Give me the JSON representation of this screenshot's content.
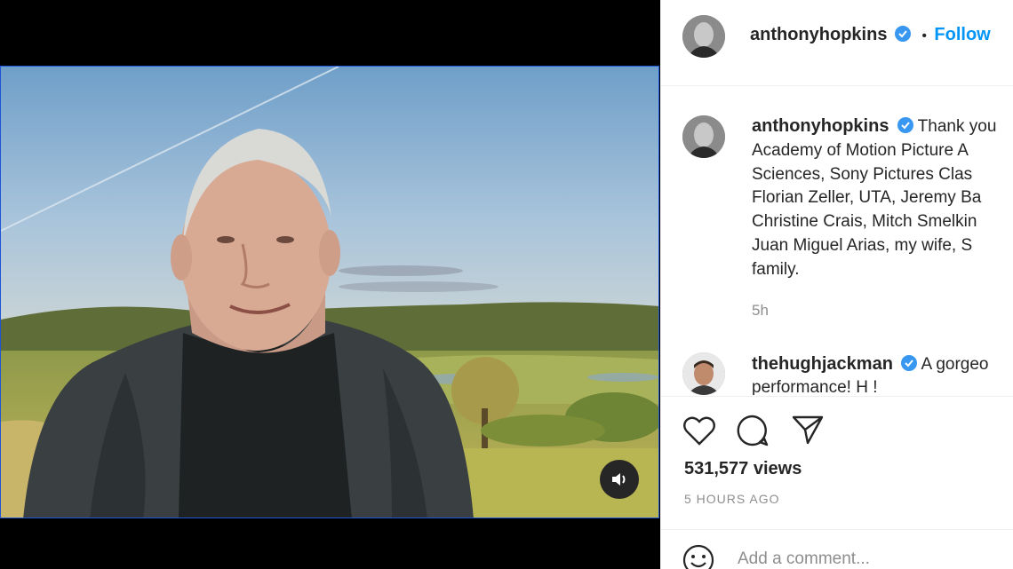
{
  "post": {
    "username": "anthonyhopkins",
    "separator": "•",
    "follow_label": "Follow"
  },
  "caption": {
    "username": "anthonyhopkins",
    "lines": [
      "Thank you",
      "Academy of Motion Picture A",
      "Sciences, Sony Pictures Clas",
      "Florian Zeller, UTA, Jeremy Ba",
      "Christine Crais, Mitch Smelkin",
      "Juan Miguel Arias, my wife, S",
      "family."
    ],
    "time": "5h"
  },
  "comment": {
    "username": "thehughjackman",
    "text_line1": "A gorgeo",
    "text_line2": "performance! H !"
  },
  "stats": {
    "views": "531,577 views",
    "posted_ago": "5 HOURS AGO"
  },
  "add_comment": {
    "placeholder": "Add a comment..."
  },
  "colors": {
    "link_blue": "#0095f6",
    "verified_blue": "#3897f0",
    "muted_gray": "#8e8e8e"
  },
  "icons": [
    "sound-on-icon",
    "verified-badge-icon",
    "heart-icon",
    "comment-icon",
    "share-icon",
    "emoji-icon"
  ]
}
